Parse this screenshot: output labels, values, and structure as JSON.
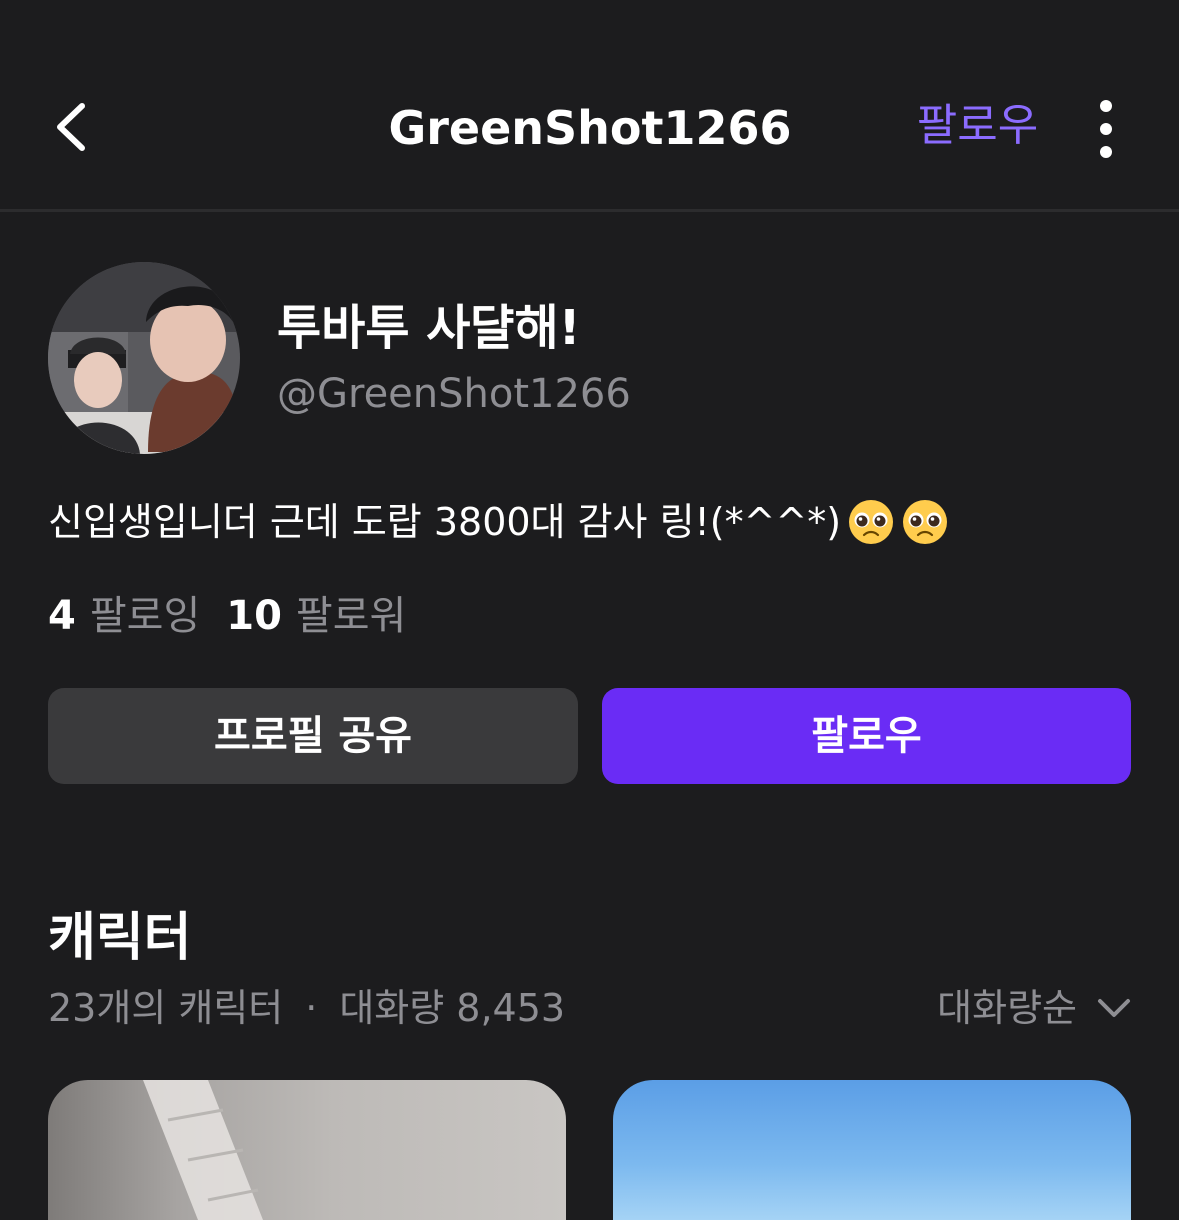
{
  "header": {
    "title": "GreenShot1266",
    "follow_label": "팔로우"
  },
  "profile": {
    "display_name": "투바투 사댤해!",
    "handle": "@GreenShot1266",
    "bio": "신입생입니더 근데 도랍 3800대 감사 링!(*^^*)",
    "bio_emojis": [
      "pleading-face",
      "pleading-face"
    ],
    "following_count": "4",
    "following_label": "팔로잉",
    "followers_count": "10",
    "followers_label": "팔로워"
  },
  "actions": {
    "share_label": "프로필 공유",
    "follow_label": "팔로우"
  },
  "characters": {
    "title": "캐릭터",
    "count_text": "23개의 캐릭터",
    "separator": "·",
    "volume_text": "대화량 8,453",
    "sort_label": "대화량순"
  },
  "colors": {
    "background": "#1c1c1e",
    "accent": "#6a2cf5",
    "accent_text": "#8b6cff",
    "muted_text": "#8e8e93",
    "secondary_button": "#3a3a3c"
  },
  "icons": [
    "chevron-left-icon",
    "more-vertical-icon",
    "chevron-down-icon"
  ]
}
